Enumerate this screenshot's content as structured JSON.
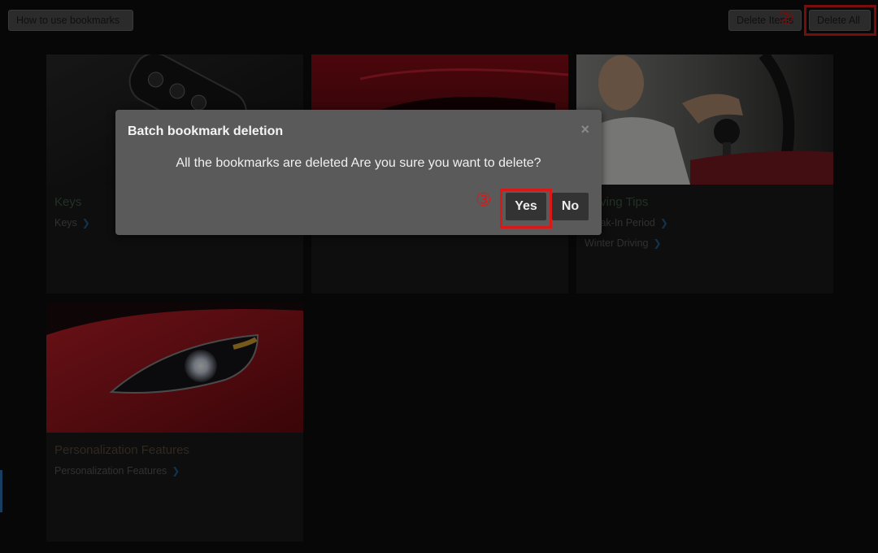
{
  "toolbar": {
    "how_to_label": "How to use bookmarks",
    "delete_items_label": "Delete Items",
    "delete_all_label": "Delete All"
  },
  "markers": {
    "step2": "②",
    "step3": "③"
  },
  "cards": [
    {
      "title": "Keys",
      "links": [
        "Keys"
      ]
    },
    {
      "title": "",
      "links": []
    },
    {
      "title": "Driving Tips",
      "links": [
        "Break-In Period",
        "Winter Driving"
      ]
    },
    {
      "title": "Personalization Features",
      "links": [
        "Personalization Features"
      ]
    }
  ],
  "dialog": {
    "title": "Batch bookmark deletion",
    "close": "×",
    "message": "All the bookmarks are deleted Are you sure you want to delete?",
    "yes_label": "Yes",
    "no_label": "No"
  },
  "colors": {
    "accent_red": "#d91818",
    "link_chevron": "#1f5d8e"
  }
}
